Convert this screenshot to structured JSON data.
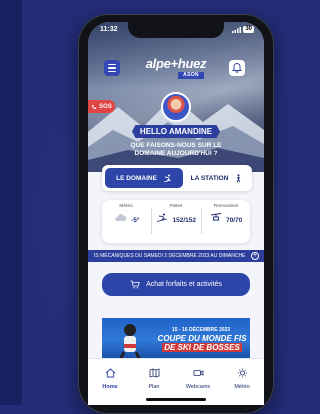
{
  "status_bar": {
    "time": "11:32",
    "battery": "30"
  },
  "header": {
    "logo_text": "alpe+huez",
    "logo_sub": "ASON",
    "menu_icon": "hamburger-icon",
    "bell_icon": "bell-icon"
  },
  "sos": {
    "label": "SOS"
  },
  "greeting": {
    "hello": "HELLO AMANDINE",
    "question": "QUE FAISONS-NOUS SUR LE DOMAINE AUJOURD'HUI ?"
  },
  "toggle": {
    "domain_label": "LE DOMAINE",
    "station_label": "LA STATION"
  },
  "weather": {
    "meteo_label": "Météo",
    "meteo_value": "-5°",
    "pistes_label": "Pistes",
    "pistes_value": "152/152",
    "remontees_label": "Remontées",
    "remontees_value": "70/70"
  },
  "ticker": {
    "text": "IS MÉCANIQUES DU SAMEDI 2 DÉCEMBRE 2023 AU DIMANCHE"
  },
  "buy_button": {
    "label": "Achat forfaits et activités"
  },
  "promo": {
    "date": "15 - 16 DÉCEMBRE 2023",
    "title_line1": "COUPE DU MONDE FIS",
    "title_line2": "DE SKI DE BOSSES"
  },
  "tabs": [
    {
      "label": "Home",
      "icon": "house-icon"
    },
    {
      "label": "Plan",
      "icon": "map-icon"
    },
    {
      "label": "Webcams",
      "icon": "camera-icon"
    },
    {
      "label": "Météo",
      "icon": "sun-icon"
    }
  ],
  "colors": {
    "primary": "#2d44a8",
    "sos": "#e04646",
    "background": "#232c76"
  }
}
